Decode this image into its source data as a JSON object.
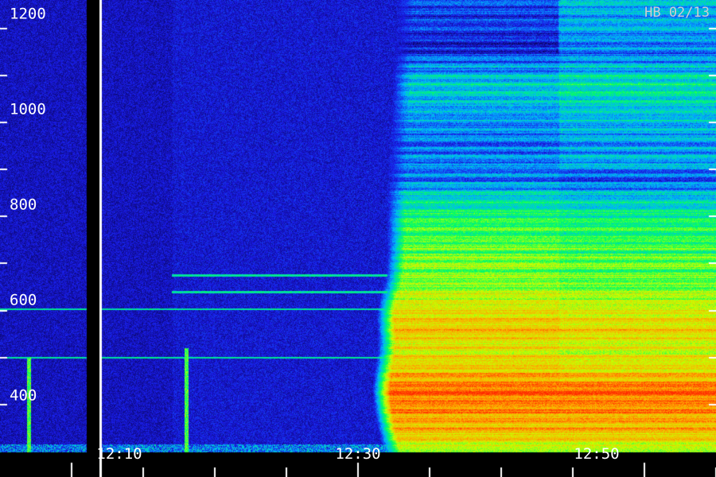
{
  "stamp": "HB 02/13",
  "chart_data": {
    "type": "heatmap",
    "title": "",
    "xlabel": "",
    "ylabel": "",
    "y_axis": {
      "range": [
        300,
        1260
      ],
      "major_ticks": [
        {
          "value": 400,
          "label": "400"
        },
        {
          "value": 600,
          "label": "600"
        },
        {
          "value": 800,
          "label": "800"
        },
        {
          "value": 1000,
          "label": "1000"
        },
        {
          "value": 1200,
          "label": "1200"
        }
      ],
      "minor_ticks": [
        500,
        700,
        900,
        1100
      ]
    },
    "x_axis": {
      "range": [
        "12:05",
        "12:55"
      ],
      "major_ticks": [
        {
          "value": "12:10",
          "label": "12:10"
        },
        {
          "value": "12:30",
          "label": "12:30"
        },
        {
          "value": "12:50",
          "label": "12:50"
        }
      ],
      "minor_ticks": [
        "12:15",
        "12:20",
        "12:25",
        "12:35",
        "12:40",
        "12:45",
        "12:55"
      ]
    },
    "data_gap": {
      "from": "12:11",
      "to": "12:12"
    },
    "colormap": [
      "#06003a",
      "#1a1ae8",
      "#00b4ff",
      "#00ff60",
      "#c8ff00",
      "#ffaa00",
      "#ff2a00"
    ],
    "events": [
      {
        "name": "onset",
        "time": "12:32",
        "freq_range": [
          300,
          1230
        ]
      },
      {
        "name": "line",
        "time_range": [
          "12:05",
          "12:55"
        ],
        "freq": 500
      },
      {
        "name": "line",
        "time_range": [
          "12:05",
          "12:32"
        ],
        "freq": 603
      },
      {
        "name": "line",
        "time_range": [
          "12:17",
          "12:32"
        ],
        "freq": 640
      },
      {
        "name": "line",
        "time_range": [
          "12:17",
          "12:32"
        ],
        "freq": 675
      },
      {
        "name": "burst",
        "time": "12:07",
        "freq_range": [
          300,
          500
        ]
      },
      {
        "name": "burst",
        "time": "12:18",
        "freq_range": [
          300,
          520
        ]
      },
      {
        "name": "burst",
        "time": "12:41",
        "freq_range": [
          300,
          480
        ]
      },
      {
        "name": "step",
        "time": "12:44"
      }
    ],
    "intensity_profile": [
      {
        "freq": 1250,
        "level": 0.3
      },
      {
        "freq": 1150,
        "level": 0.22
      },
      {
        "freq": 1080,
        "level": 0.38
      },
      {
        "freq": 1000,
        "level": 0.3
      },
      {
        "freq": 960,
        "level": 0.26
      },
      {
        "freq": 880,
        "level": 0.28
      },
      {
        "freq": 840,
        "level": 0.4
      },
      {
        "freq": 790,
        "level": 0.52
      },
      {
        "freq": 740,
        "level": 0.55
      },
      {
        "freq": 700,
        "level": 0.6
      },
      {
        "freq": 660,
        "level": 0.6
      },
      {
        "freq": 620,
        "level": 0.68
      },
      {
        "freq": 560,
        "level": 0.8
      },
      {
        "freq": 520,
        "level": 0.72
      },
      {
        "freq": 480,
        "level": 0.76
      },
      {
        "freq": 430,
        "level": 0.92
      },
      {
        "freq": 380,
        "level": 0.86
      },
      {
        "freq": 330,
        "level": 0.78
      },
      {
        "freq": 300,
        "level": 0.62
      }
    ]
  }
}
